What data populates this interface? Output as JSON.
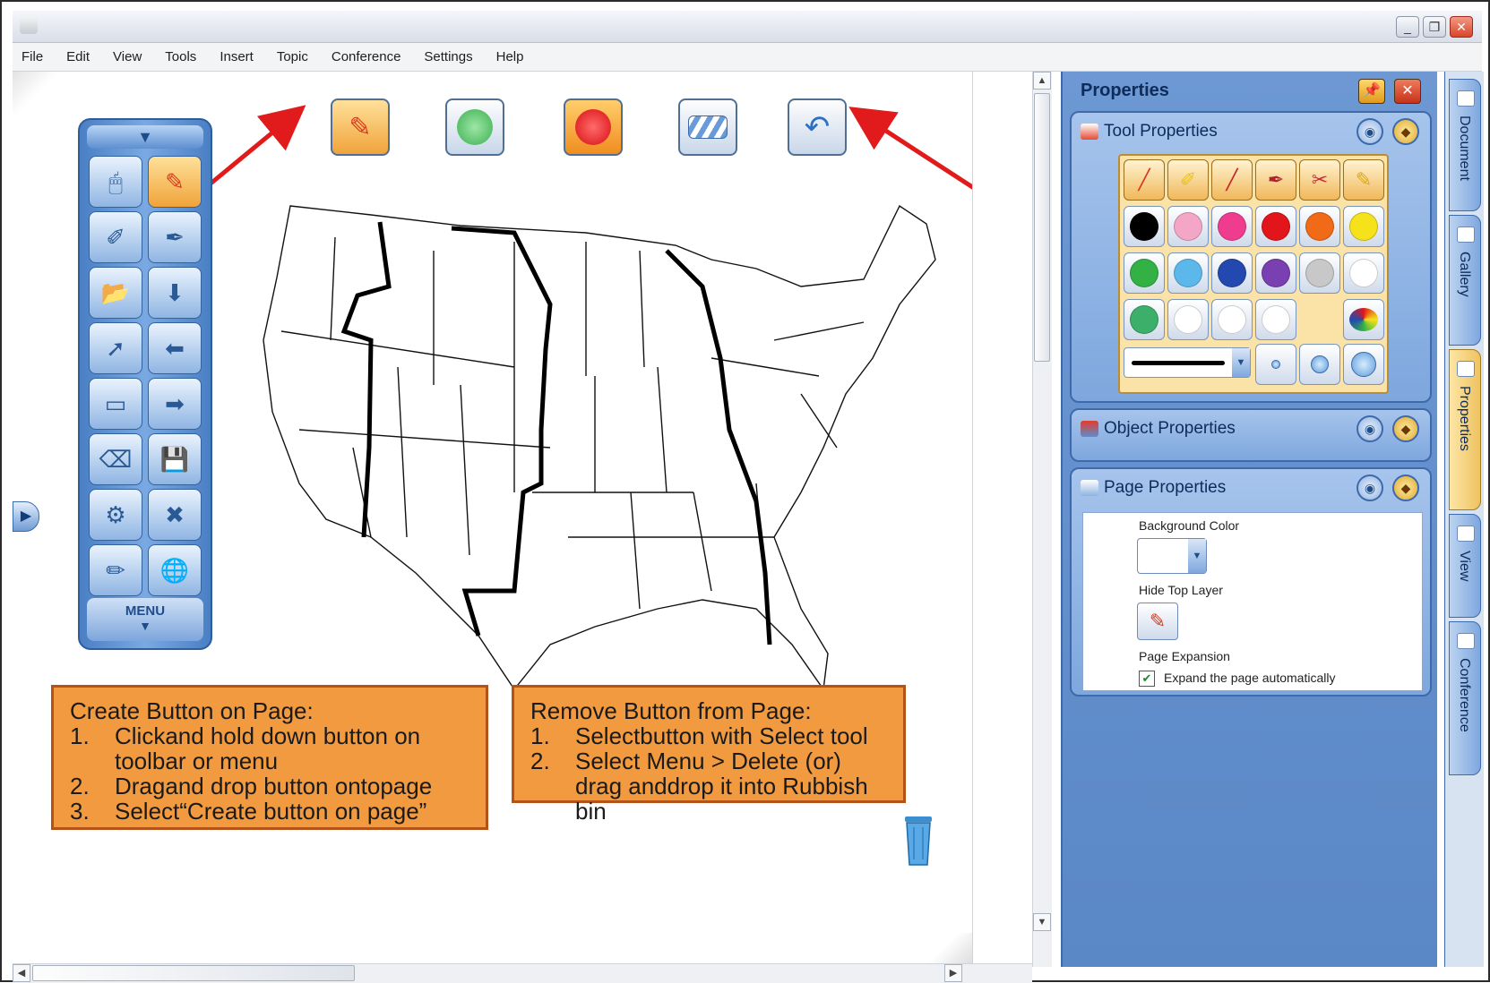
{
  "menu": [
    "File",
    "Edit",
    "View",
    "Tools",
    "Insert",
    "Topic",
    "Conference",
    "Settings",
    "Help"
  ],
  "window_controls": {
    "minimize": "_",
    "restore": "❐",
    "close": "✕"
  },
  "float_toolbar": {
    "menu_label": "MENU",
    "tools": [
      {
        "name": "mouse-tool-button",
        "icon": "mouse-icon",
        "glyph": "🖱"
      },
      {
        "name": "pen-tool-button",
        "icon": "pen-icon",
        "glyph": "✎"
      },
      {
        "name": "highlighter-tool-button",
        "icon": "highlighter-icon",
        "glyph": "✐"
      },
      {
        "name": "magic-pen-button",
        "icon": "magic-pen-icon",
        "glyph": "✒"
      },
      {
        "name": "open-file-button",
        "icon": "open-folder-icon",
        "glyph": "📂"
      },
      {
        "name": "import-button",
        "icon": "import-arrow-icon",
        "glyph": "⬇"
      },
      {
        "name": "select-tool-button",
        "icon": "cursor-arrow-icon",
        "glyph": "➚"
      },
      {
        "name": "previous-page-button",
        "icon": "back-arrow-icon",
        "glyph": "⬅"
      },
      {
        "name": "eraser-tool-button",
        "icon": "eraser-icon",
        "glyph": "▭"
      },
      {
        "name": "next-page-button",
        "icon": "forward-arrow-icon",
        "glyph": "➡"
      },
      {
        "name": "clear-button",
        "icon": "clear-eraser-icon",
        "glyph": "⌫"
      },
      {
        "name": "save-button",
        "icon": "floppy-disk-icon",
        "glyph": "💾"
      },
      {
        "name": "resources-button",
        "icon": "globe-tools-icon",
        "glyph": "⚙"
      },
      {
        "name": "delete-page-button",
        "icon": "delete-page-icon",
        "glyph": "✖"
      },
      {
        "name": "gallery-tools-button",
        "icon": "drawing-tools-icon",
        "glyph": "✏"
      },
      {
        "name": "web-button",
        "icon": "web-globe-icon",
        "glyph": "🌐"
      }
    ]
  },
  "page_buttons": [
    {
      "name": "page-pen-button",
      "icon": "pen-icon",
      "glyph": "✎",
      "color": "#d93a1e"
    },
    {
      "name": "page-green-button",
      "icon": "green-circle-icon",
      "glyph": "●",
      "color": "#4cbb5a"
    },
    {
      "name": "page-red-button",
      "icon": "red-circle-icon",
      "glyph": "●",
      "color": "#e2151b"
    },
    {
      "name": "page-eraser-button",
      "icon": "eraser-icon",
      "glyph": "▭",
      "color": "#5d8ccf"
    },
    {
      "name": "page-undo-button",
      "icon": "undo-arrow-icon",
      "glyph": "↶",
      "color": "#2b6fc7"
    }
  ],
  "callouts": {
    "create": {
      "title": "Create Button on Page:",
      "steps": [
        {
          "num": "1.",
          "text": "Clickand hold down button on toolbar or menu"
        },
        {
          "num": "2.",
          "text": "Dragand drop button ontopage"
        },
        {
          "num": "3.",
          "text": "Select“Create button on page”"
        }
      ]
    },
    "remove": {
      "title": "Remove Button from Page:",
      "steps": [
        {
          "num": "1.",
          "text": "Selectbutton with Select tool"
        },
        {
          "num": "2.",
          "text": "Select Menu > Delete (or) drag anddrop it into Rubbish bin"
        }
      ]
    }
  },
  "properties_panel": {
    "title": "Properties",
    "sections": {
      "tool": "Tool Properties",
      "object": "Object Properties",
      "page": "Page Properties"
    },
    "palette_colors": [
      [
        "#000000",
        "#f4a6c6",
        "#ef3c8f",
        "#e2151b",
        "#f06a18",
        "#f5e21a"
      ],
      [
        "#33b145",
        "#5cb8ea",
        "#2349b0",
        "#7a3fb0",
        "#c8c8c8",
        "#ffffff"
      ],
      [
        "#3cb06a",
        "#ffffff",
        "#ffffff",
        "#ffffff",
        "",
        ""
      ]
    ],
    "tool_tips": [
      "pen",
      "highlighter",
      "calligraphy-pen",
      "magic-pen",
      "tweezers",
      "brush"
    ],
    "page": {
      "background_color_label": "Background Color",
      "hide_top_layer_label": "Hide Top Layer",
      "page_expansion_label": "Page Expansion",
      "expand_checkbox_label": "Expand the page automatically",
      "expand_checked": true
    }
  },
  "side_tabs": [
    "Document",
    "Gallery",
    "Properties",
    "View",
    "Conference"
  ],
  "active_side_tab": "Properties"
}
